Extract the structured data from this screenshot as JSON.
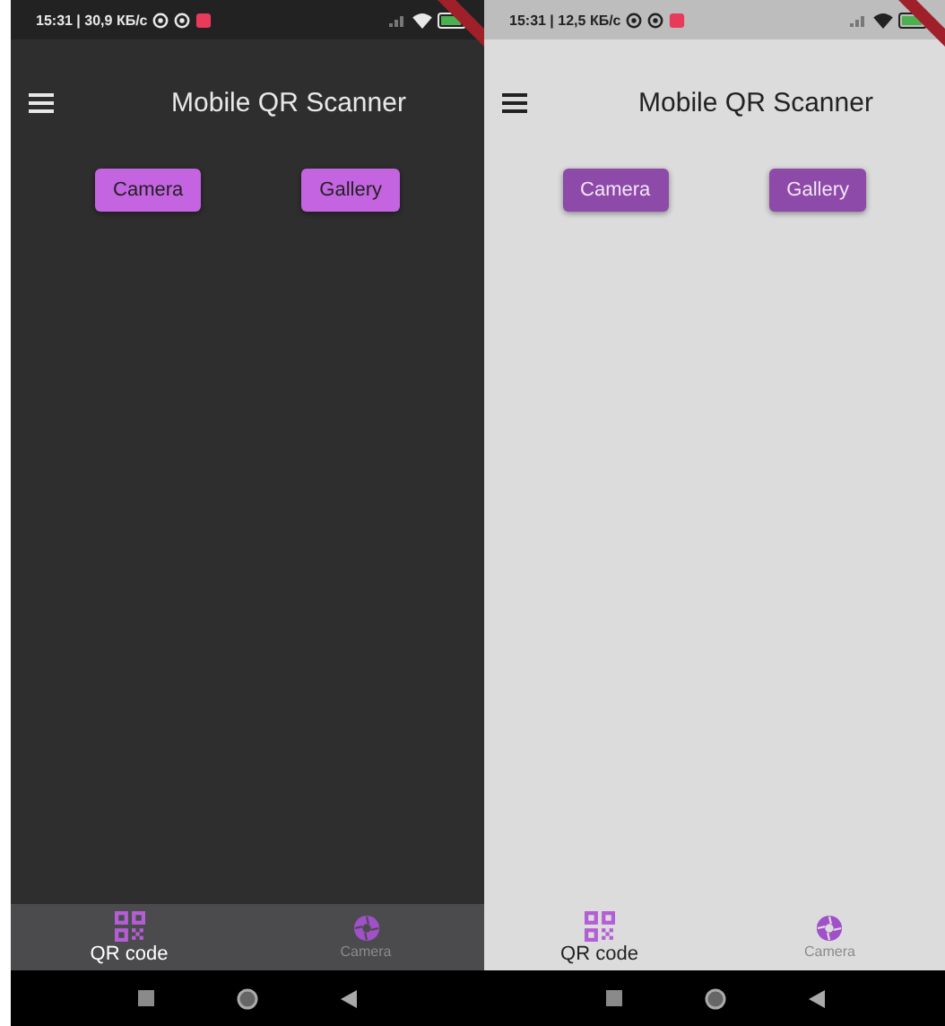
{
  "screens": [
    {
      "kind": "dark",
      "status": "15:31 | 30,9 КБ/с",
      "title": "Mobile QR Scanner",
      "buttons": [
        "Camera",
        "Gallery"
      ],
      "nav": [
        {
          "label": "QR code",
          "kind": "qr",
          "selected": true
        },
        {
          "label": "Camera",
          "kind": "camera",
          "selected": false
        }
      ]
    },
    {
      "kind": "light",
      "status": "15:31 | 12,5 КБ/с",
      "title": "Mobile QR Scanner",
      "buttons": [
        "Camera",
        "Gallery"
      ],
      "nav": [
        {
          "label": "QR code",
          "kind": "qr",
          "selected": true
        },
        {
          "label": "Camera",
          "kind": "camera",
          "selected": false
        }
      ]
    }
  ]
}
